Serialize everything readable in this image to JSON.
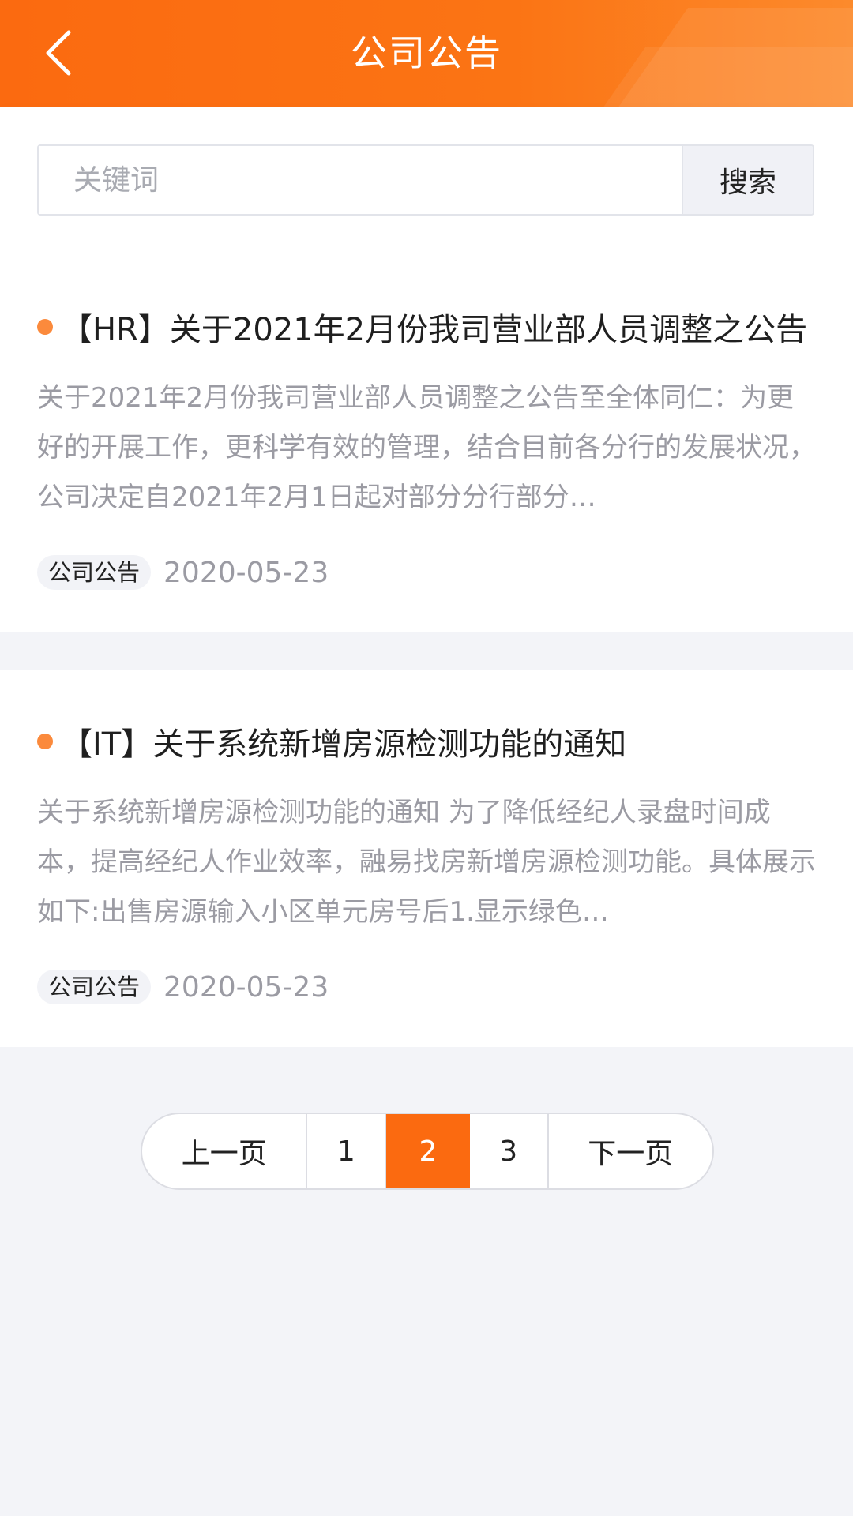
{
  "header": {
    "title": "公司公告",
    "back_icon": "chevron-left-icon",
    "background_color": "#fb6a10"
  },
  "search": {
    "placeholder": "关键词",
    "value": "",
    "button_label": "搜索"
  },
  "announcements": [
    {
      "title": "【HR】关于2021年2月份我司营业部人员调整之公告",
      "summary": "关于2021年2月份我司营业部人员调整之公告至全体同仁：为更好的开展工作，更科学有效的管理，结合目前各分行的发展状况，公司决定自2021年2月1日起对部分分行部分…",
      "category": "公司公告",
      "date": "2020-05-23"
    },
    {
      "title": "【IT】关于系统新增房源检测功能的通知",
      "summary": "关于系统新增房源检测功能的通知  为了降低经纪人录盘时间成本，提高经纪人作业效率，融易找房新增房源检测功能。具体展示如下:出售房源输入小区单元房号后1.显示绿色…",
      "category": "公司公告",
      "date": "2020-05-23"
    }
  ],
  "pagination": {
    "prev_label": "上一页",
    "pages": [
      "1",
      "2",
      "3"
    ],
    "current_page": "2",
    "next_label": "下一页",
    "accent_color": "#fb6a10"
  },
  "colors": {
    "dot": "#fb8a3c",
    "page_background": "#f3f4f8"
  }
}
